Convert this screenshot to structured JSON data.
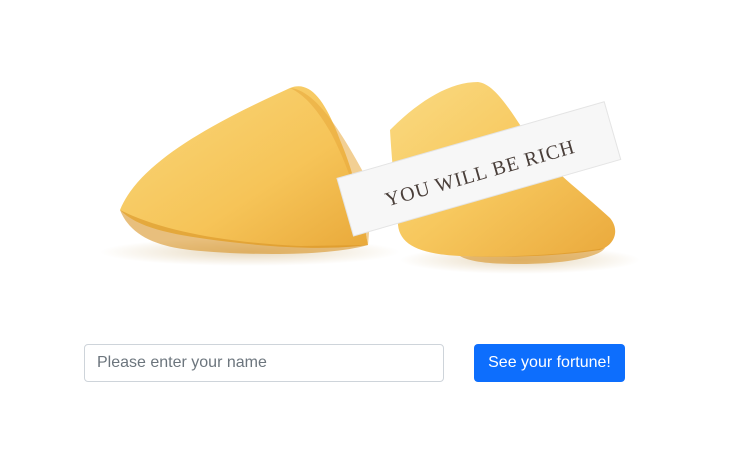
{
  "hero": {
    "fortune_text": "YOU WILL BE RICH"
  },
  "form": {
    "name_placeholder": "Please enter your name",
    "name_value": "",
    "submit_label": "See your fortune!"
  },
  "colors": {
    "button": "#0d6efd",
    "cookie": "#f6c85f",
    "paper": "#f7f7f7"
  }
}
